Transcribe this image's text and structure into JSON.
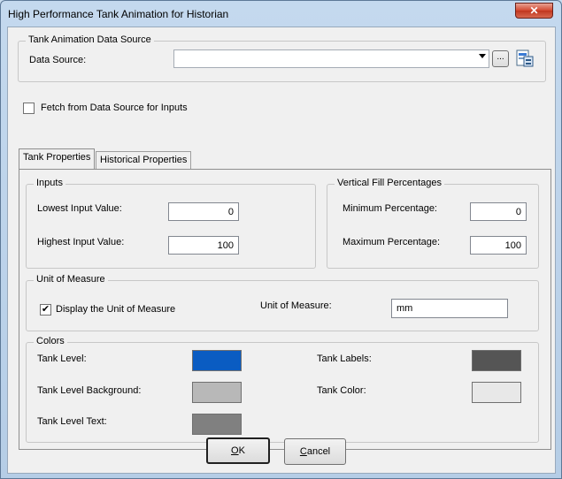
{
  "window": {
    "title": "High Performance Tank Animation for Historian",
    "close_glyph": "✕"
  },
  "data_source": {
    "group_label": "Tank Animation Data Source",
    "label": "Data Source:",
    "value": "",
    "browse_label": "..."
  },
  "fetch": {
    "label": "Fetch from Data Source for Inputs",
    "checked": false
  },
  "tabs": [
    {
      "label": "Tank Properties",
      "active": true
    },
    {
      "label": "Historical Properties",
      "active": false
    }
  ],
  "inputs": {
    "group_label": "Inputs",
    "lowest_label": "Lowest Input Value:",
    "lowest_value": "0",
    "highest_label": "Highest Input Value:",
    "highest_value": "100"
  },
  "fill": {
    "group_label": "Vertical Fill Percentages",
    "min_label": "Minimum Percentage:",
    "min_value": "0",
    "max_label": "Maximum Percentage:",
    "max_value": "100"
  },
  "unit": {
    "group_label": "Unit of Measure",
    "display_label": "Display the Unit of Measure",
    "display_checked": true,
    "check_glyph": "✔",
    "field_label": "Unit of Measure:",
    "field_value": "mm"
  },
  "colors": {
    "group_label": "Colors",
    "tank_level_label": "Tank Level:",
    "tank_level_color": "#0a5cc2",
    "tank_level_bg_label": "Tank Level Background:",
    "tank_level_bg_color": "#b8b8b8",
    "tank_level_text_label": "Tank Level Text:",
    "tank_level_text_color": "#808080",
    "tank_labels_label": "Tank Labels:",
    "tank_labels_color": "#555555",
    "tank_color_label": "Tank Color:",
    "tank_color_color": "#e8e8e8"
  },
  "buttons": {
    "ok_mnemonic": "O",
    "ok_rest": "K",
    "cancel_mnemonic": "C",
    "cancel_rest": "ancel"
  }
}
